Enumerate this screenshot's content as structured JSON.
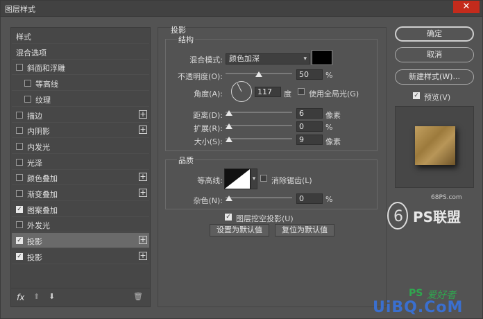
{
  "window": {
    "title": "图层样式",
    "close_glyph": "✕"
  },
  "styles_list": {
    "items": [
      {
        "label": "样式",
        "checkbox": false,
        "checked": false,
        "plus": false,
        "indent": false,
        "selected": false
      },
      {
        "label": "混合选项",
        "checkbox": false,
        "checked": false,
        "plus": false,
        "indent": false,
        "selected": false
      },
      {
        "label": "斜面和浮雕",
        "checkbox": true,
        "checked": false,
        "plus": false,
        "indent": false,
        "selected": false
      },
      {
        "label": "等高线",
        "checkbox": true,
        "checked": false,
        "plus": false,
        "indent": true,
        "selected": false
      },
      {
        "label": "纹理",
        "checkbox": true,
        "checked": false,
        "plus": false,
        "indent": true,
        "selected": false
      },
      {
        "label": "描边",
        "checkbox": true,
        "checked": false,
        "plus": true,
        "indent": false,
        "selected": false
      },
      {
        "label": "内阴影",
        "checkbox": true,
        "checked": false,
        "plus": true,
        "indent": false,
        "selected": false
      },
      {
        "label": "内发光",
        "checkbox": true,
        "checked": false,
        "plus": false,
        "indent": false,
        "selected": false
      },
      {
        "label": "光泽",
        "checkbox": true,
        "checked": false,
        "plus": false,
        "indent": false,
        "selected": false
      },
      {
        "label": "颜色叠加",
        "checkbox": true,
        "checked": false,
        "plus": true,
        "indent": false,
        "selected": false
      },
      {
        "label": "渐变叠加",
        "checkbox": true,
        "checked": false,
        "plus": true,
        "indent": false,
        "selected": false
      },
      {
        "label": "图案叠加",
        "checkbox": true,
        "checked": true,
        "plus": false,
        "indent": false,
        "selected": false
      },
      {
        "label": "外发光",
        "checkbox": true,
        "checked": false,
        "plus": false,
        "indent": false,
        "selected": false
      },
      {
        "label": "投影",
        "checkbox": true,
        "checked": true,
        "plus": true,
        "indent": false,
        "selected": true
      },
      {
        "label": "投影",
        "checkbox": true,
        "checked": true,
        "plus": true,
        "indent": false,
        "selected": false
      }
    ],
    "footer": {
      "fx": "fx",
      "up_glyph": "⬆",
      "down_glyph": "⬇",
      "trash_glyph": "🗑"
    }
  },
  "drop_shadow": {
    "section_title": "投影",
    "structure_title": "结构",
    "blend_mode_label": "混合模式:",
    "blend_mode_value": "颜色加深",
    "shadow_color": "#000000",
    "opacity_label": "不透明度(O):",
    "opacity_value": "50",
    "opacity_unit": "%",
    "opacity_fraction": 0.5,
    "angle_label": "角度(A):",
    "angle_value": "117",
    "angle_unit": "度",
    "global_light_label": "使用全局光(G)",
    "global_light_checked": false,
    "distance_label": "距离(D):",
    "distance_value": "6",
    "distance_unit": "像素",
    "distance_fraction": 0.03,
    "spread_label": "扩展(R):",
    "spread_value": "0",
    "spread_unit": "%",
    "spread_fraction": 0.0,
    "size_label": "大小(S):",
    "size_value": "9",
    "size_unit": "像素",
    "size_fraction": 0.04,
    "quality_title": "品质",
    "contour_label": "等高线:",
    "anti_alias_label": "消除锯齿(L)",
    "anti_alias_checked": false,
    "noise_label": "杂色(N):",
    "noise_value": "0",
    "noise_unit": "%",
    "noise_fraction": 0.0,
    "knockout_label": "图层挖空投影(U)",
    "knockout_checked": true,
    "set_default_label": "设置为默认值",
    "reset_default_label": "复位为默认值"
  },
  "right_panel": {
    "ok_label": "确定",
    "cancel_label": "取消",
    "new_style_label": "新建样式(W)...",
    "preview_label": "预览(V)",
    "preview_checked": true
  },
  "watermarks": {
    "site_small": "68PS.com",
    "logo_text": "PS联盟",
    "bottom_ps": "PS",
    "bottom_cn": "爱好者",
    "bottom_site": "UiBQ.CoM"
  },
  "colors": {
    "dialog_bg": "#535353",
    "list_bg": "#474747",
    "selected_row": "#6a6a6a",
    "close_button": "#c42b1c",
    "watermark_green": "#2fa84f",
    "watermark_blue": "#3a6fcf"
  },
  "icons": [
    "close-icon",
    "plus-icon",
    "fx-icon",
    "move-up-icon",
    "move-down-icon",
    "trash-icon",
    "chevron-down-icon",
    "check-icon"
  ]
}
